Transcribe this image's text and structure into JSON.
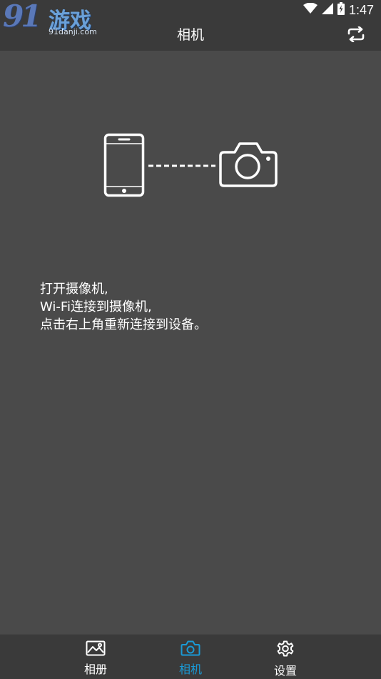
{
  "status_bar": {
    "time": "1:47",
    "icons": [
      "wifi-icon",
      "signal-icon",
      "battery-charging-icon"
    ]
  },
  "watermark": {
    "logo_digits": "91",
    "logo_text": "游戏",
    "url": "91danji.com"
  },
  "app_bar": {
    "title": "相机",
    "action_icon": "refresh-icon"
  },
  "illustration": {
    "icons": [
      "phone-icon",
      "camera-icon"
    ]
  },
  "instructions": {
    "line1": "打开摄像机,",
    "line2": "Wi-Fi连接到摄像机,",
    "line3": "点击右上角重新连接到设备。"
  },
  "bottom_nav": {
    "items": [
      {
        "label": "相册",
        "icon": "gallery-icon",
        "active": false
      },
      {
        "label": "相机",
        "icon": "camera-icon",
        "active": true
      },
      {
        "label": "设置",
        "icon": "gear-icon",
        "active": false
      }
    ]
  },
  "colors": {
    "background": "#4a4a4a",
    "bars": "#3a3a3a",
    "accent": "#1a9ad6",
    "text": "#ffffff"
  }
}
